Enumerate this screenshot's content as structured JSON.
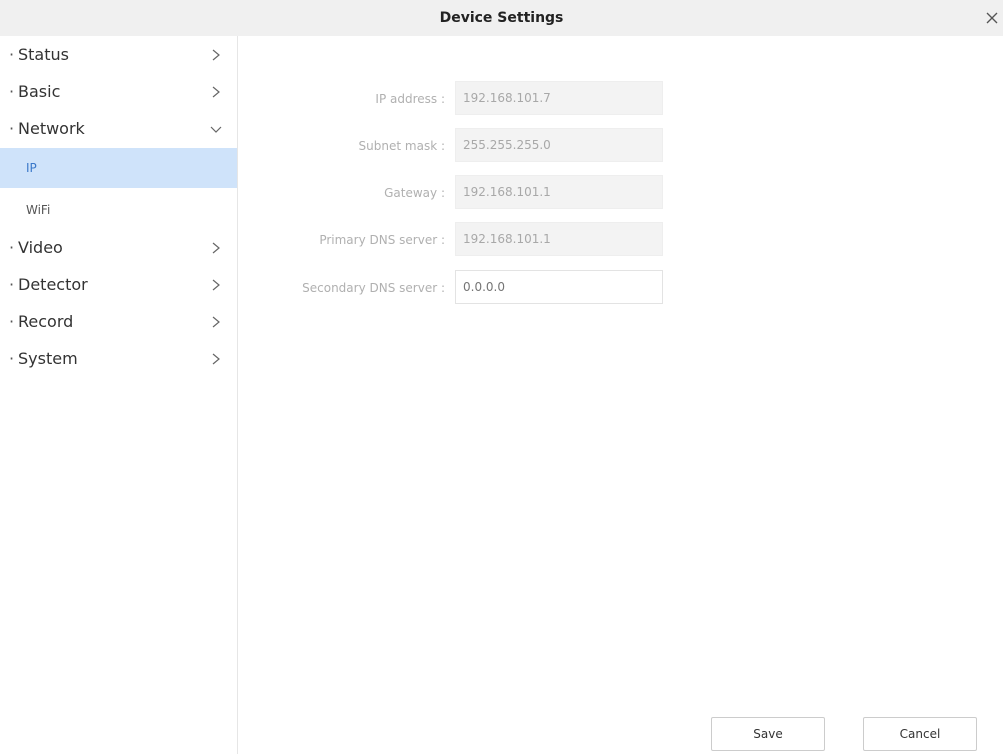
{
  "window": {
    "title": "Device Settings"
  },
  "sidebar": {
    "items": [
      {
        "label": "Status",
        "expanded": false
      },
      {
        "label": "Basic",
        "expanded": false
      },
      {
        "label": "Network",
        "expanded": true,
        "children": [
          {
            "label": "IP",
            "active": true
          },
          {
            "label": "WiFi",
            "active": false
          }
        ]
      },
      {
        "label": "Video",
        "expanded": false
      },
      {
        "label": "Detector",
        "expanded": false
      },
      {
        "label": "Record",
        "expanded": false
      },
      {
        "label": "System",
        "expanded": false
      }
    ]
  },
  "form": {
    "ip_address": {
      "label": "IP address :",
      "value": "192.168.101.7"
    },
    "subnet_mask": {
      "label": "Subnet mask :",
      "value": "255.255.255.0"
    },
    "gateway": {
      "label": "Gateway :",
      "value": "192.168.101.1"
    },
    "primary_dns": {
      "label": "Primary DNS server :",
      "value": "192.168.101.1"
    },
    "secondary_dns": {
      "label": "Secondary DNS server :",
      "placeholder": "0.0.0.0"
    }
  },
  "actions": {
    "save_label": "Save",
    "cancel_label": "Cancel"
  },
  "colors": {
    "active_bg": "#cfe3fa",
    "active_text": "#3a78c9",
    "titlebar_bg": "#f0f0f0"
  },
  "icons": {
    "close": "close-icon",
    "chevron_right": "chevron-right-icon",
    "chevron_down": "chevron-down-icon"
  }
}
